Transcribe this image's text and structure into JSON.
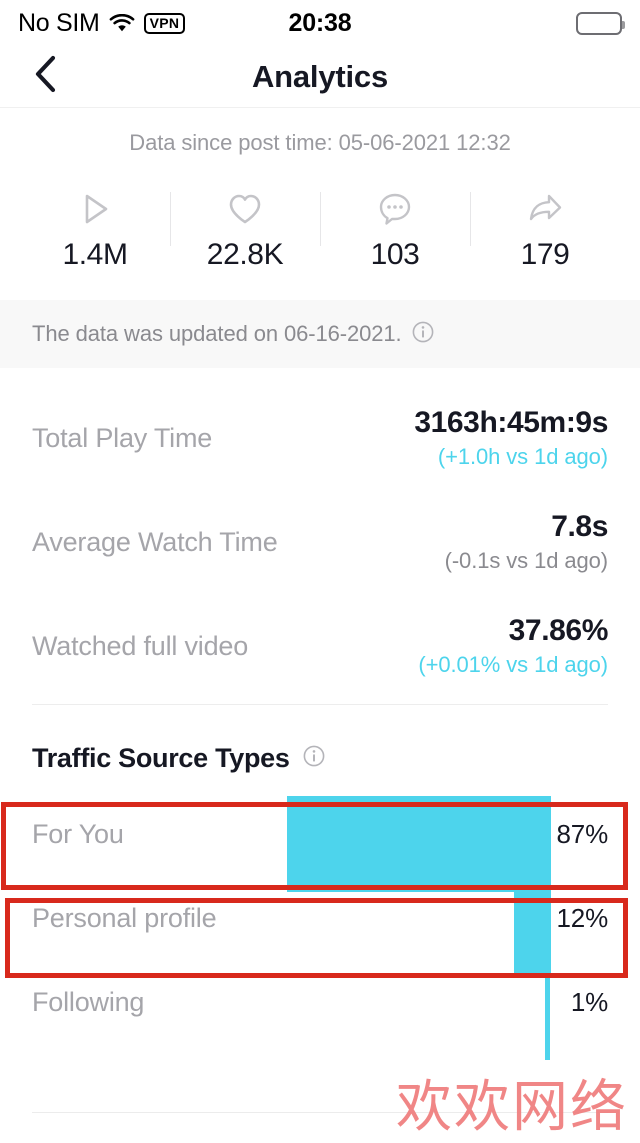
{
  "status_bar": {
    "carrier": "No SIM",
    "vpn_label": "VPN",
    "time": "20:38",
    "wifi_icon": "wifi-icon",
    "battery_icon": "battery-icon"
  },
  "nav": {
    "title": "Analytics",
    "back_icon": "chevron-left-icon"
  },
  "since_line": "Data since post time: 05-06-2021 12:32",
  "stats": [
    {
      "icon": "play-icon",
      "value": "1.4M"
    },
    {
      "icon": "heart-icon",
      "value": "22.8K"
    },
    {
      "icon": "comment-icon",
      "value": "103"
    },
    {
      "icon": "share-icon",
      "value": "179"
    }
  ],
  "updated_banner": {
    "text": "The data was updated on 06-16-2021.",
    "info_icon": "info-icon"
  },
  "metrics": [
    {
      "label": "Total Play Time",
      "value": "3163h:45m:9s",
      "delta": "(+1.0h vs 1d ago)",
      "delta_color": "#4dd4ec"
    },
    {
      "label": "Average Watch Time",
      "value": "7.8s",
      "delta": "(-0.1s vs 1d ago)",
      "delta_color": "#8a8a8f"
    },
    {
      "label": "Watched full video",
      "value": "37.86%",
      "delta": "(+0.01% vs 1d ago)",
      "delta_color": "#4dd4ec"
    }
  ],
  "traffic": {
    "title": "Traffic Source Types",
    "info_icon": "info-icon",
    "accent_color": "#4dd4ec",
    "highlight_color": "#d8291c"
  },
  "chart_data": {
    "type": "bar",
    "title": "Traffic Source Types",
    "orientation": "horizontal-right-aligned",
    "categories": [
      "For You",
      "Personal profile",
      "Following"
    ],
    "values": [
      87,
      12,
      1
    ],
    "value_labels": [
      "87%",
      "12%",
      "1%"
    ],
    "xlabel": "",
    "ylabel": "",
    "xlim": [
      0,
      100
    ],
    "grid": false,
    "legend": false,
    "bar_color": "#4dd4ec"
  },
  "watermark": "欢欢网络"
}
